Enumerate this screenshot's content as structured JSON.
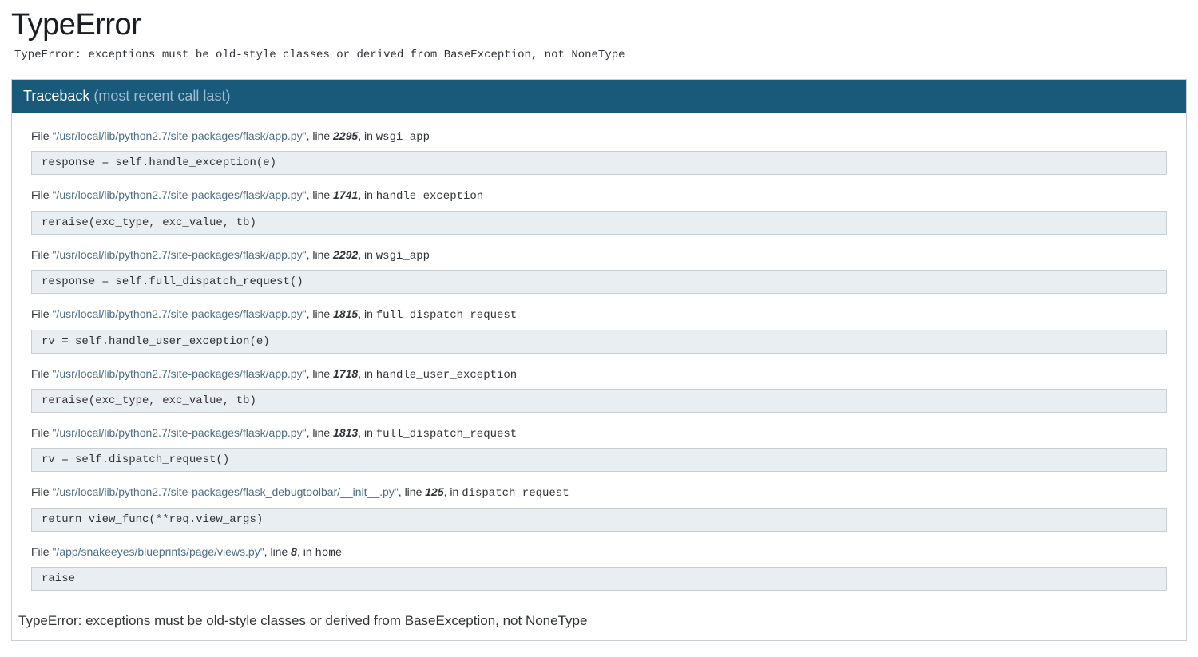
{
  "title": "TypeError",
  "error_message": "TypeError: exceptions must be old-style classes or derived from BaseException, not NoneType",
  "traceback_label": "Traceback",
  "traceback_muted": "(most recent call last)",
  "file_word": "File",
  "line_word": "line",
  "in_word": "in",
  "frames": [
    {
      "path": "\"/usr/local/lib/python2.7/site-packages/flask/app.py\"",
      "line": "2295",
      "func": "wsgi_app",
      "code": "response = self.handle_exception(e)"
    },
    {
      "path": "\"/usr/local/lib/python2.7/site-packages/flask/app.py\"",
      "line": "1741",
      "func": "handle_exception",
      "code": "reraise(exc_type, exc_value, tb)"
    },
    {
      "path": "\"/usr/local/lib/python2.7/site-packages/flask/app.py\"",
      "line": "2292",
      "func": "wsgi_app",
      "code": "response = self.full_dispatch_request()"
    },
    {
      "path": "\"/usr/local/lib/python2.7/site-packages/flask/app.py\"",
      "line": "1815",
      "func": "full_dispatch_request",
      "code": "rv = self.handle_user_exception(e)"
    },
    {
      "path": "\"/usr/local/lib/python2.7/site-packages/flask/app.py\"",
      "line": "1718",
      "func": "handle_user_exception",
      "code": "reraise(exc_type, exc_value, tb)"
    },
    {
      "path": "\"/usr/local/lib/python2.7/site-packages/flask/app.py\"",
      "line": "1813",
      "func": "full_dispatch_request",
      "code": "rv = self.dispatch_request()"
    },
    {
      "path": "\"/usr/local/lib/python2.7/site-packages/flask_debugtoolbar/__init__.py\"",
      "line": "125",
      "func": "dispatch_request",
      "code": "return view_func(**req.view_args)"
    },
    {
      "path": "\"/app/snakeeyes/blueprints/page/views.py\"",
      "line": "8",
      "func": "home",
      "code": "raise"
    }
  ],
  "bottom_error": "TypeError: exceptions must be old-style classes or derived from BaseException, not NoneType"
}
